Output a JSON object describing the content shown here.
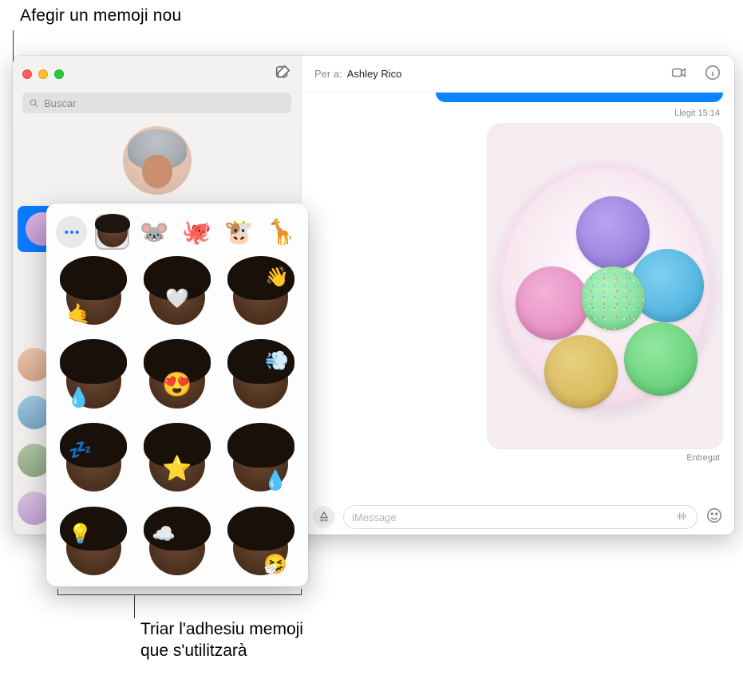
{
  "callouts": {
    "top": "Afegir un memoji nou",
    "bottom_line1": "Triar l'adhesiu memoji",
    "bottom_line2": "que s'utilitzarà"
  },
  "sidebar": {
    "search_placeholder": "Buscar",
    "compose_icon": "compose-icon"
  },
  "header": {
    "to_label": "Per a:",
    "to_name": "Ashley Rico"
  },
  "messages": {
    "read_receipt": "Llegit 15:14",
    "delivered": "Entregat",
    "image_alt": "plate-of-macarons"
  },
  "compose": {
    "placeholder": "iMessage"
  },
  "popover": {
    "more_icon": "ellipsis",
    "avatars": [
      {
        "name": "memoji-person",
        "emoji": ""
      },
      {
        "name": "mouse",
        "emoji": "🐭"
      },
      {
        "name": "octopus",
        "emoji": "🐙"
      },
      {
        "name": "cow",
        "emoji": "🐮"
      },
      {
        "name": "giraffe",
        "emoji": "🦒"
      }
    ],
    "stickers": [
      {
        "name": "call-me",
        "badge": "🤙",
        "pos": "b-bl"
      },
      {
        "name": "heart-hands",
        "badge": "🤍",
        "pos": "b-c"
      },
      {
        "name": "wave",
        "badge": "👋",
        "pos": "b-tr"
      },
      {
        "name": "tears-of-joy",
        "badge": "💧",
        "pos": "b-bl"
      },
      {
        "name": "heart-eyes",
        "badge": "😍",
        "pos": "b-c"
      },
      {
        "name": "mind-blown",
        "badge": "💨",
        "pos": "b-tr"
      },
      {
        "name": "sleepy",
        "badge": "💤",
        "pos": "b-tl"
      },
      {
        "name": "star-struck",
        "badge": "⭐",
        "pos": "b-c"
      },
      {
        "name": "tear",
        "badge": "💧",
        "pos": "b-br"
      },
      {
        "name": "idea",
        "badge": "💡",
        "pos": "b-tl"
      },
      {
        "name": "cloudy",
        "badge": "☁️",
        "pos": "b-tl"
      },
      {
        "name": "sneeze",
        "badge": "🤧",
        "pos": "b-br"
      }
    ]
  }
}
